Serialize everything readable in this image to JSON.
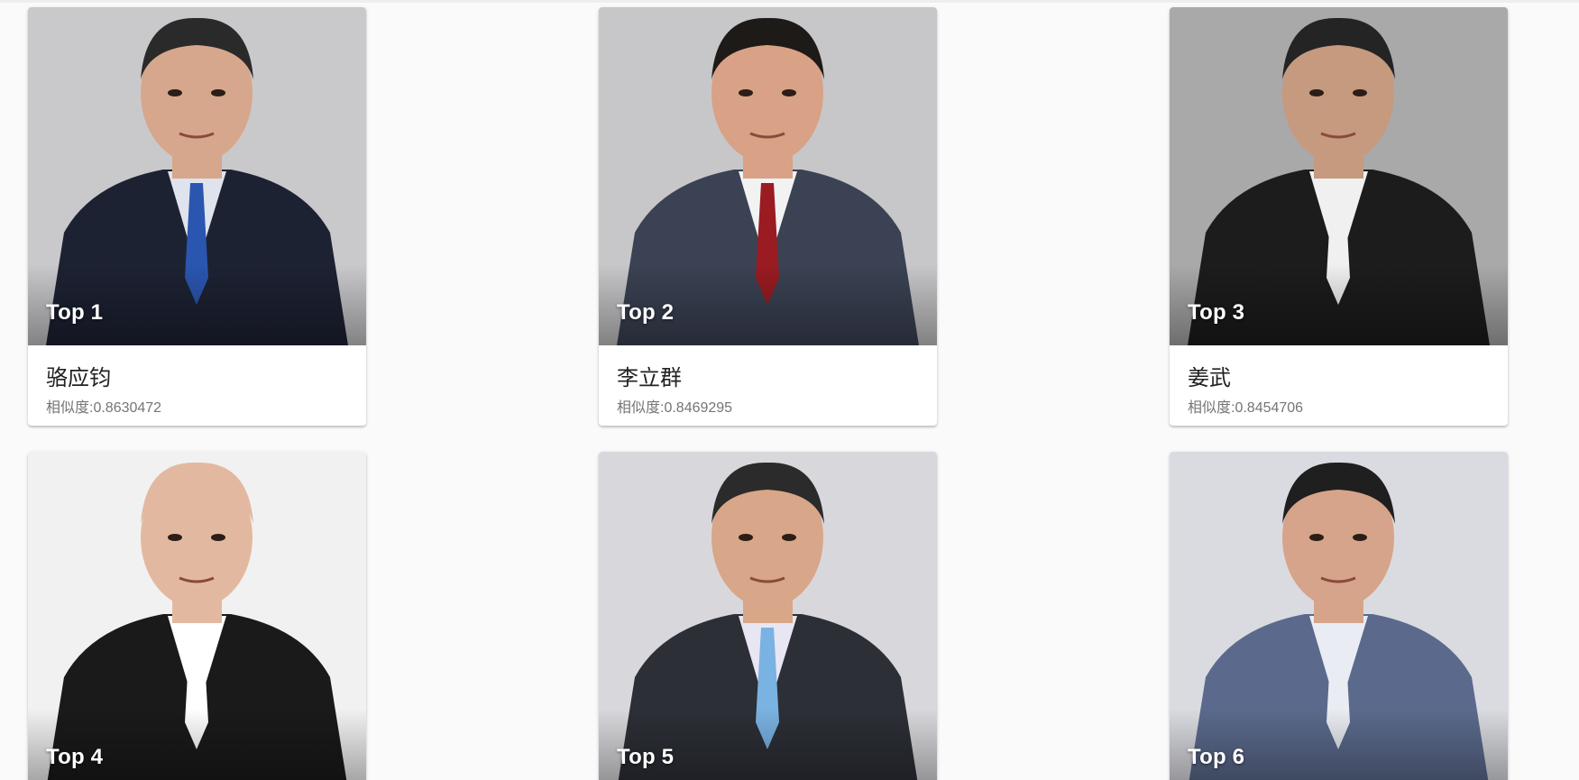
{
  "results": [
    {
      "rank": "Top 1",
      "name": "骆应钧",
      "similarity": "相似度:0.8630472",
      "bg": "#c9c9cc",
      "suit": "#1d2233",
      "skin": "#d6a78c",
      "hair": "#2a2a2a",
      "shirt": "#dfe3ee",
      "accent": "#2a56b0"
    },
    {
      "rank": "Top 2",
      "name": "李立群",
      "similarity": "相似度:0.8469295",
      "bg": "#c7c7c9",
      "suit": "#3a4253",
      "skin": "#d9a185",
      "hair": "#1e1a18",
      "shirt": "#f2f2f2",
      "accent": "#9a1b22"
    },
    {
      "rank": "Top 3",
      "name": "姜武",
      "similarity": "相似度:0.8454706",
      "bg": "#a9a9a9",
      "suit": "#1c1c1c",
      "skin": "#c59a7e",
      "hair": "#242424",
      "shirt": "#f0f0f0",
      "accent": "#f0f0f0"
    },
    {
      "rank": "Top 4",
      "name": "",
      "similarity": "",
      "bg": "#f1f1f1",
      "suit": "#1a1a1a",
      "skin": "#e2b9a0",
      "hair": "#e2b9a0",
      "shirt": "#ffffff",
      "accent": "#ffffff"
    },
    {
      "rank": "Top 5",
      "name": "",
      "similarity": "",
      "bg": "#d8d8dc",
      "suit": "#2c2f36",
      "skin": "#d8a688",
      "hair": "#2b2b2b",
      "shirt": "#e8e6f2",
      "accent": "#7ab2e2"
    },
    {
      "rank": "Top 6",
      "name": "",
      "similarity": "",
      "bg": "#dadbe0",
      "suit": "#5b6a8c",
      "skin": "#d6a48a",
      "hair": "#1f1f1f",
      "shirt": "#e9edf3",
      "accent": "#e9edf3"
    }
  ]
}
